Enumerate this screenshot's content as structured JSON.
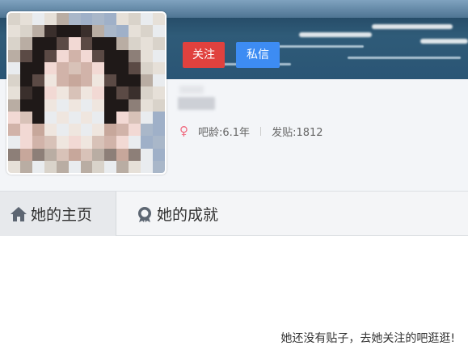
{
  "header": {
    "follow_label": "关注",
    "message_label": "私信"
  },
  "profile": {
    "gender_symbol": "♀",
    "bar_age": "吧龄:6.1年",
    "posts": "发贴:1812"
  },
  "tabs": [
    {
      "label": "她的主页",
      "icon": "home-icon",
      "active": true
    },
    {
      "label": "她的成就",
      "icon": "medal-icon",
      "active": false
    }
  ],
  "content": {
    "empty_message": "她还没有贴子，去她关注的吧逛逛!"
  },
  "colors": {
    "follow": "#e0413e",
    "message": "#3d8cf3",
    "gender": "#f06b80"
  }
}
